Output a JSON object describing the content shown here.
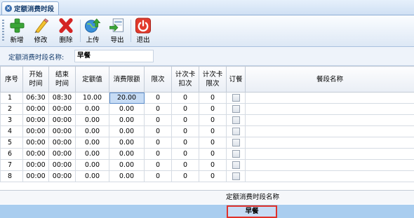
{
  "tab": {
    "title": "定额消费时段"
  },
  "toolbar": {
    "add": "新增",
    "edit": "修改",
    "delete": "删除",
    "upload": "上传",
    "export": "导出",
    "exit": "退出"
  },
  "form": {
    "label": "定额消费时段名称:",
    "value": "早餐"
  },
  "table": {
    "headers": {
      "seq": "序号",
      "start": "开始\n时间",
      "end": "结束\n时间",
      "quota": "定额值",
      "limit": "消费限额",
      "times": "限次",
      "card_deduct": "计次卡\n扣次",
      "card_limit": "计次卡\n限次",
      "order": "订餐",
      "meal_name": "餐段名称"
    },
    "rows": [
      {
        "seq": "1",
        "start": "06:30",
        "end": "08:30",
        "quota": "10.00",
        "limit": "20.00",
        "times": "0",
        "card_deduct": "0",
        "card_limit": "0",
        "meal_name": ""
      },
      {
        "seq": "2",
        "start": "00:00",
        "end": "00:00",
        "quota": "0.00",
        "limit": "0.00",
        "times": "0",
        "card_deduct": "0",
        "card_limit": "0",
        "meal_name": ""
      },
      {
        "seq": "3",
        "start": "00:00",
        "end": "00:00",
        "quota": "0.00",
        "limit": "0.00",
        "times": "0",
        "card_deduct": "0",
        "card_limit": "0",
        "meal_name": ""
      },
      {
        "seq": "4",
        "start": "00:00",
        "end": "00:00",
        "quota": "0.00",
        "limit": "0.00",
        "times": "0",
        "card_deduct": "0",
        "card_limit": "0",
        "meal_name": ""
      },
      {
        "seq": "5",
        "start": "00:00",
        "end": "00:00",
        "quota": "0.00",
        "limit": "0.00",
        "times": "0",
        "card_deduct": "0",
        "card_limit": "0",
        "meal_name": ""
      },
      {
        "seq": "6",
        "start": "00:00",
        "end": "00:00",
        "quota": "0.00",
        "limit": "0.00",
        "times": "0",
        "card_deduct": "0",
        "card_limit": "0",
        "meal_name": ""
      },
      {
        "seq": "7",
        "start": "00:00",
        "end": "00:00",
        "quota": "0.00",
        "limit": "0.00",
        "times": "0",
        "card_deduct": "0",
        "card_limit": "0",
        "meal_name": ""
      },
      {
        "seq": "8",
        "start": "00:00",
        "end": "00:00",
        "quota": "0.00",
        "limit": "0.00",
        "times": "0",
        "card_deduct": "0",
        "card_limit": "0",
        "meal_name": ""
      }
    ]
  },
  "footer": {
    "column_label": "定额消费时段名称",
    "selected_value": "早餐"
  },
  "colors": {
    "accent": "#3b6fb0",
    "highlight": "#e0312a",
    "selection": "#c7dcf5",
    "footer_bar": "#a9cdef"
  }
}
